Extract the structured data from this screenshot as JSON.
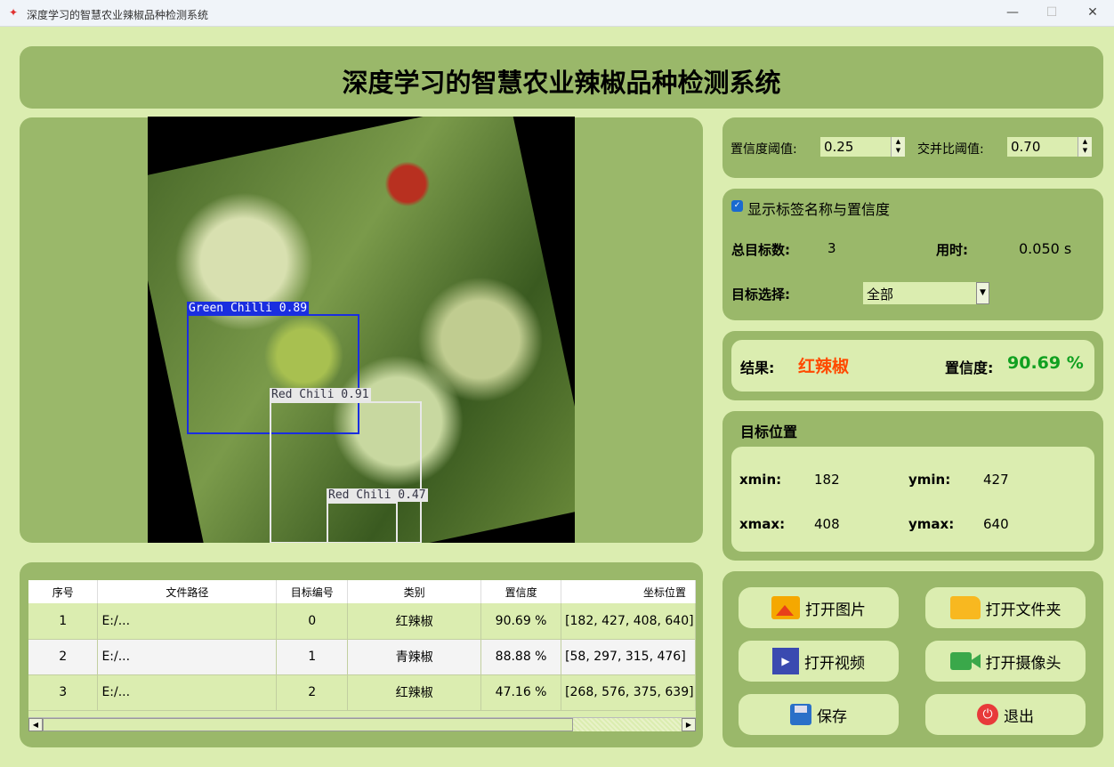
{
  "window": {
    "title": "深度学习的智慧农业辣椒品种检测系统",
    "minimize": "—",
    "maximize": "☐",
    "close": "✕"
  },
  "header": {
    "title": "深度学习的智慧农业辣椒品种检测系统"
  },
  "detections_overlay": [
    {
      "label": "Green Chilli 0.89",
      "color": "#1a2ee0"
    },
    {
      "label": "Red Chili 0.91",
      "color": "#e8e8e8"
    },
    {
      "label": "Red Chili 0.47",
      "color": "#e8e8e8"
    }
  ],
  "params": {
    "conf_label": "置信度阈值:",
    "conf_value": "0.25",
    "iou_label": "交并比阈值:",
    "iou_value": "0.70"
  },
  "info": {
    "show_label": "显示标签名称与置信度",
    "show_checked": true,
    "total_label": "总目标数:",
    "total_value": "3",
    "time_label": "用时:",
    "time_value": "0.050 s",
    "select_label": "目标选择:",
    "select_value": "全部"
  },
  "result": {
    "label": "结果:",
    "value": "红辣椒",
    "conf_label": "置信度:",
    "conf_value": "90.69 %",
    "value_color": "#ff4a00",
    "conf_color": "#10a020"
  },
  "position": {
    "title": "目标位置",
    "xmin_label": "xmin:",
    "xmin": "182",
    "ymin_label": "ymin:",
    "ymin": "427",
    "xmax_label": "xmax:",
    "xmax": "408",
    "ymax_label": "ymax:",
    "ymax": "640"
  },
  "buttons": {
    "open_image": "打开图片",
    "open_folder": "打开文件夹",
    "open_video": "打开视频",
    "open_camera": "打开摄像头",
    "save": "保存",
    "exit": "退出"
  },
  "table": {
    "headers": [
      "序号",
      "文件路径",
      "目标编号",
      "类别",
      "置信度",
      "坐标位置"
    ],
    "rows": [
      [
        "1",
        "E:/...",
        "0",
        "红辣椒",
        "90.69 %",
        "[182, 427, 408, 640]"
      ],
      [
        "2",
        "E:/...",
        "1",
        "青辣椒",
        "88.88 %",
        "[58, 297, 315, 476]"
      ],
      [
        "3",
        "E:/...",
        "2",
        "红辣椒",
        "47.16 %",
        "[268, 576, 375, 639]"
      ]
    ]
  }
}
